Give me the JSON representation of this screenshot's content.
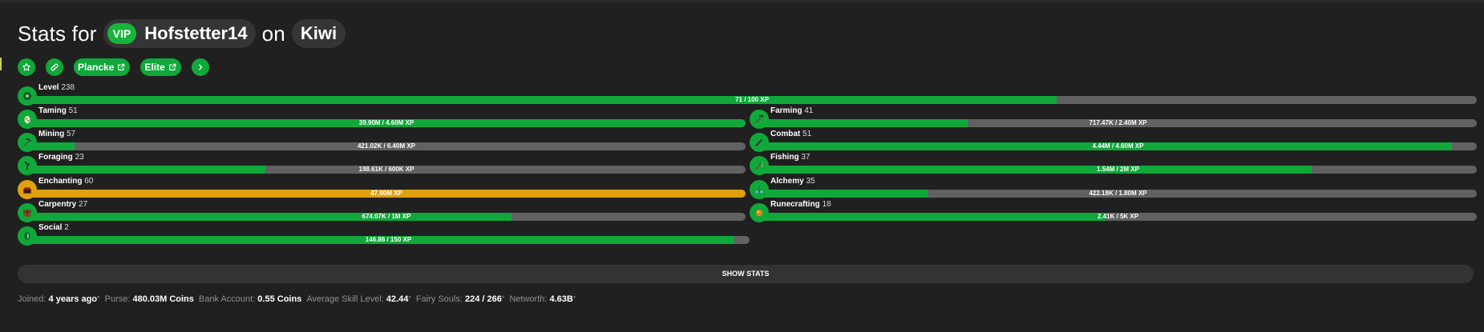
{
  "header": {
    "prefix": "Stats for",
    "vip_badge": "VIP",
    "player": "Hofstetter14",
    "joiner": "on",
    "profile": "Kiwi"
  },
  "toolbar": {
    "links": [
      {
        "label": "Plancke",
        "icon": "external-link-icon"
      },
      {
        "label": "Elite",
        "icon": "external-link-icon"
      }
    ],
    "icons": [
      "star-icon",
      "link-icon",
      "chevron-right-icon"
    ]
  },
  "level": {
    "name": "Level",
    "level": "238",
    "text": "71 / 100 XP",
    "progress": 0.71
  },
  "skills": [
    {
      "name": "Taming",
      "level": "51",
      "text": "39.90M / 4.60M XP",
      "progress": 1.0,
      "icon": "spawn-egg-icon"
    },
    {
      "name": "Farming",
      "level": "41",
      "text": "717.47K / 2.40M XP",
      "progress": 0.29,
      "icon": "hoe-icon"
    },
    {
      "name": "Mining",
      "level": "57",
      "text": "421.02K / 6.40M XP",
      "progress": 0.066,
      "icon": "pickaxe-icon"
    },
    {
      "name": "Combat",
      "level": "51",
      "text": "4.44M / 4.60M XP",
      "progress": 0.965,
      "icon": "sword-icon"
    },
    {
      "name": "Foraging",
      "level": "23",
      "text": "198.61K / 600K XP",
      "progress": 0.331,
      "icon": "sapling-icon"
    },
    {
      "name": "Fishing",
      "level": "37",
      "text": "1.54M / 2M XP",
      "progress": 0.77,
      "icon": "fishing-rod-icon"
    },
    {
      "name": "Enchanting",
      "level": "60",
      "text": "47.90M XP",
      "progress": 1.0,
      "maxed": true,
      "icon": "enchanting-table-icon"
    },
    {
      "name": "Alchemy",
      "level": "35",
      "text": "422.18K / 1.80M XP",
      "progress": 0.235,
      "icon": "brewing-stand-icon"
    },
    {
      "name": "Carpentry",
      "level": "27",
      "text": "674.07K / 1M XP",
      "progress": 0.674,
      "icon": "crafting-table-icon"
    },
    {
      "name": "Runecrafting",
      "level": "18",
      "text": "2.41K / 5K XP",
      "progress": 0.482,
      "icon": "magma-cream-icon"
    },
    {
      "name": "Social",
      "level": "2",
      "text": "146.86 / 150 XP",
      "progress": 0.979,
      "icon": "emerald-icon"
    }
  ],
  "show_stats": "SHOW STATS",
  "footer": {
    "joined_label": "Joined:",
    "joined_value": "4 years ago",
    "purse_label": "Purse:",
    "purse_value": "480.03M Coins",
    "bank_label": "Bank Account:",
    "bank_value": "0.55 Coins",
    "avg_label": "Average Skill Level:",
    "avg_value": "42.44",
    "souls_label": "Fairy Souls:",
    "souls_value": "224 / 266",
    "networth_label": "Networth:",
    "networth_value": "4.63B",
    "asterisk": "*"
  },
  "colors": {
    "accent": "#10a83a",
    "maxed": "#e0a010",
    "track": "#616161",
    "background": "#202020"
  }
}
